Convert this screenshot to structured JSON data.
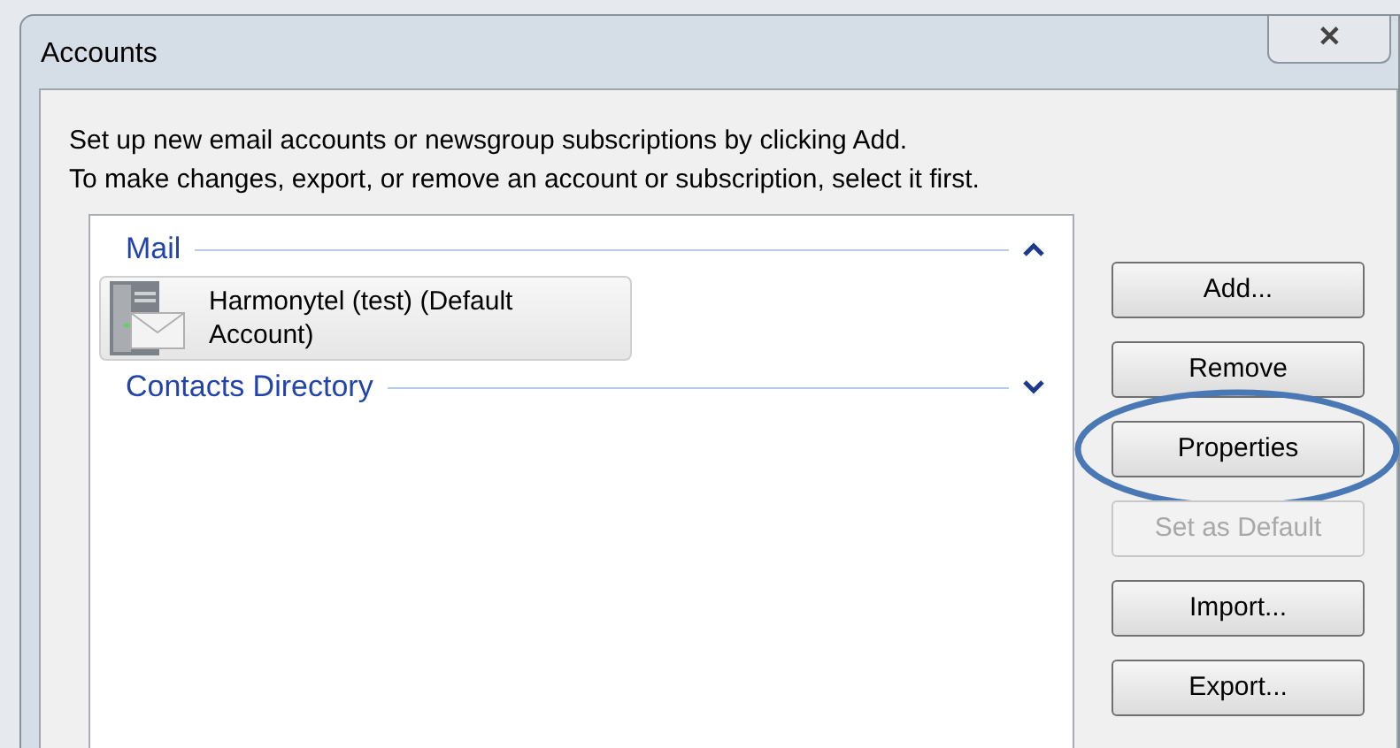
{
  "window": {
    "title": "Accounts",
    "close_label": "✕"
  },
  "instructions": [
    "Set up new email accounts or newsgroup subscriptions by clicking Add.",
    "To make changes, export, or remove an account or subscription, select it first."
  ],
  "groups": [
    {
      "label": "Mail",
      "expanded": true,
      "accounts": [
        {
          "name": "Harmonytel (test) (Default Account)",
          "selected": true
        }
      ]
    },
    {
      "label": "Contacts Directory",
      "expanded": false
    }
  ],
  "buttons": [
    {
      "label": "Add...",
      "disabled": false,
      "circled": false
    },
    {
      "label": "Remove",
      "disabled": false,
      "circled": false
    },
    {
      "label": "Properties",
      "disabled": false,
      "circled": true
    },
    {
      "label": "Set as Default",
      "disabled": true,
      "circled": false
    },
    {
      "label": "Import...",
      "disabled": false,
      "circled": false
    },
    {
      "label": "Export...",
      "disabled": false,
      "circled": false
    }
  ]
}
